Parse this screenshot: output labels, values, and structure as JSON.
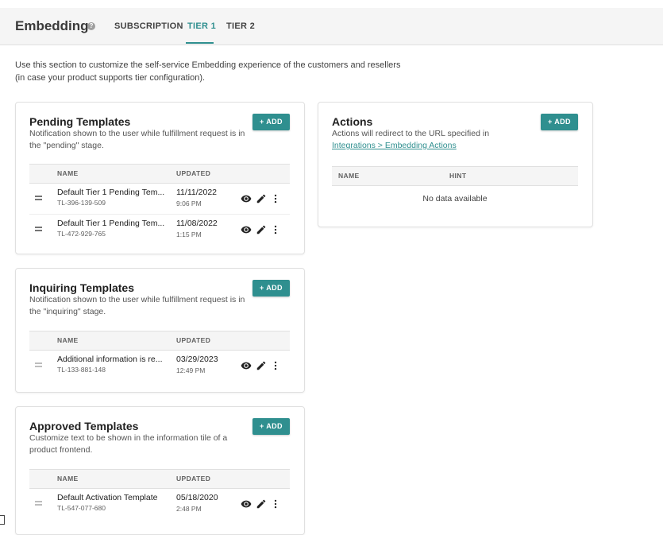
{
  "header": {
    "title": "Embedding",
    "tabs": [
      {
        "label": "SUBSCRIPTION",
        "active": false
      },
      {
        "label": "TIER 1",
        "active": true
      },
      {
        "label": "TIER 2",
        "active": false
      }
    ]
  },
  "intro": "Use this section to customize the self-service Embedding experience of the customers and resellers (in case your product supports tier configuration).",
  "common": {
    "add_label": "+ ADD",
    "col_name": "NAME",
    "col_updated": "UPDATED",
    "col_hint": "HINT"
  },
  "pending": {
    "title": "Pending Templates",
    "description": "Notification shown to the user while fulfillment request is in the \"pending\" stage.",
    "rows": [
      {
        "name": "Default Tier 1 Pending Tem...",
        "id": "TL-396-139-509",
        "date": "11/11/2022",
        "time": "9:06 PM"
      },
      {
        "name": "Default Tier 1 Pending Tem...",
        "id": "TL-472-929-765",
        "date": "11/08/2022",
        "time": "1:15 PM"
      }
    ]
  },
  "inquiring": {
    "title": "Inquiring Templates",
    "description": "Notification shown to the user while fulfillment request is in the \"inquiring\" stage.",
    "rows": [
      {
        "name": "Additional information is re...",
        "id": "TL-133-881-148",
        "date": "03/29/2023",
        "time": "12:49 PM"
      }
    ]
  },
  "approved": {
    "title": "Approved Templates",
    "description": "Customize text to be shown in the information tile of a product frontend.",
    "rows": [
      {
        "name": "Default Activation Template",
        "id": "TL-547-077-680",
        "date": "05/18/2020",
        "time": "2:48 PM"
      }
    ]
  },
  "actions": {
    "title": "Actions",
    "description": "Actions will redirect to the URL specified in",
    "link": "Integrations > Embedding Actions",
    "empty": "No data available"
  },
  "colors": {
    "accent": "#2f8f8f"
  }
}
